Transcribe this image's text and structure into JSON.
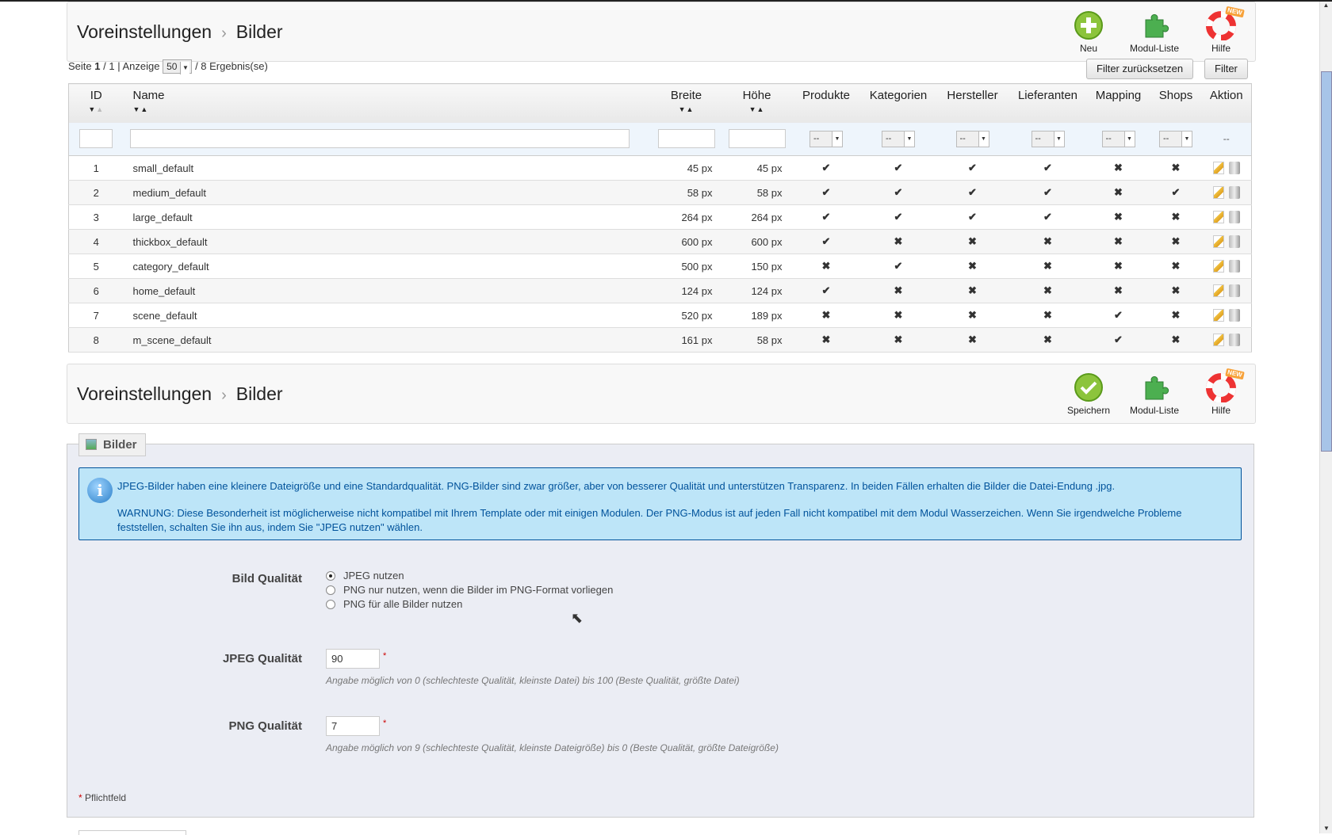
{
  "header": {
    "crumb1": "Voreinstellungen",
    "sep": "›",
    "crumb2": "Bilder",
    "new": "Neu",
    "modules": "Modul-Liste",
    "help": "Hilfe",
    "help_badge": "NEW"
  },
  "pagination": {
    "prefix": "Seite",
    "page": "1",
    "total_pages": "/ 1 | Anzeige",
    "per_page": "50",
    "results": "/ 8 Ergebnis(se)"
  },
  "filter_buttons": {
    "reset": "Filter zurücksetzen",
    "filter": "Filter"
  },
  "table": {
    "columns": [
      "ID",
      "Name",
      "Breite",
      "Höhe",
      "Produkte",
      "Kategorien",
      "Hersteller",
      "Lieferanten",
      "Mapping",
      "Shops",
      "Aktion"
    ],
    "filter_select": "--",
    "filter_action": "--",
    "rows": [
      {
        "id": "1",
        "name": "small_default",
        "w": "45 px",
        "h": "45 px",
        "flags": [
          1,
          1,
          1,
          1,
          0,
          0
        ]
      },
      {
        "id": "2",
        "name": "medium_default",
        "w": "58 px",
        "h": "58 px",
        "flags": [
          1,
          1,
          1,
          1,
          0,
          1
        ]
      },
      {
        "id": "3",
        "name": "large_default",
        "w": "264 px",
        "h": "264 px",
        "flags": [
          1,
          1,
          1,
          1,
          0,
          0
        ]
      },
      {
        "id": "4",
        "name": "thickbox_default",
        "w": "600 px",
        "h": "600 px",
        "flags": [
          1,
          0,
          0,
          0,
          0,
          0
        ]
      },
      {
        "id": "5",
        "name": "category_default",
        "w": "500 px",
        "h": "150 px",
        "flags": [
          0,
          1,
          0,
          0,
          0,
          0
        ]
      },
      {
        "id": "6",
        "name": "home_default",
        "w": "124 px",
        "h": "124 px",
        "flags": [
          1,
          0,
          0,
          0,
          0,
          0
        ]
      },
      {
        "id": "7",
        "name": "scene_default",
        "w": "520 px",
        "h": "189 px",
        "flags": [
          0,
          0,
          0,
          0,
          1,
          0
        ]
      },
      {
        "id": "8",
        "name": "m_scene_default",
        "w": "161 px",
        "h": "58 px",
        "flags": [
          0,
          0,
          0,
          0,
          1,
          0
        ]
      }
    ]
  },
  "header2": {
    "crumb1": "Voreinstellungen",
    "sep": "›",
    "crumb2": "Bilder",
    "save": "Speichern",
    "modules": "Modul-Liste",
    "help": "Hilfe",
    "help_badge": "NEW"
  },
  "form": {
    "legend": "Bilder",
    "info1": "JPEG-Bilder haben eine kleinere Dateigröße und eine Standardqualität. PNG-Bilder sind zwar größer, aber von besserer Qualität und unterstützen Transparenz. In beiden Fällen erhalten die Bilder die Datei-Endung .jpg.",
    "info2": "WARNUNG: Diese Besonderheit ist möglicherweise nicht kompatibel mit Ihrem Template oder mit einigen Modulen. Der PNG-Modus ist auf jeden Fall nicht kompatibel mit dem Modul Wasserzeichen. Wenn Sie irgendwelche Probleme feststellen, schalten Sie ihn aus, indem Sie \"JPEG nutzen\" wählen.",
    "quality_label": "Bild Qualität",
    "options": [
      "JPEG nutzen",
      "PNG nur nutzen, wenn die Bilder im PNG-Format vorliegen",
      "PNG für alle Bilder nutzen"
    ],
    "selected_option": 0,
    "jpeg_label": "JPEG Qualität",
    "jpeg_value": "90",
    "jpeg_hint": "Angabe möglich von 0 (schlechteste Qualität, kleinste Datei) bis 100 (Beste Qualität, größte Datei)",
    "png_label": "PNG Qualität",
    "png_value": "7",
    "png_hint": "Angabe möglich von 9 (schlechteste Qualität, kleinste Dateigröße) bis 0 (Beste Qualität, größte Dateigröße)",
    "required_star": "*",
    "required_note": "Pflichtfeld"
  },
  "icons": {
    "ok": "✔",
    "no": "✖"
  }
}
